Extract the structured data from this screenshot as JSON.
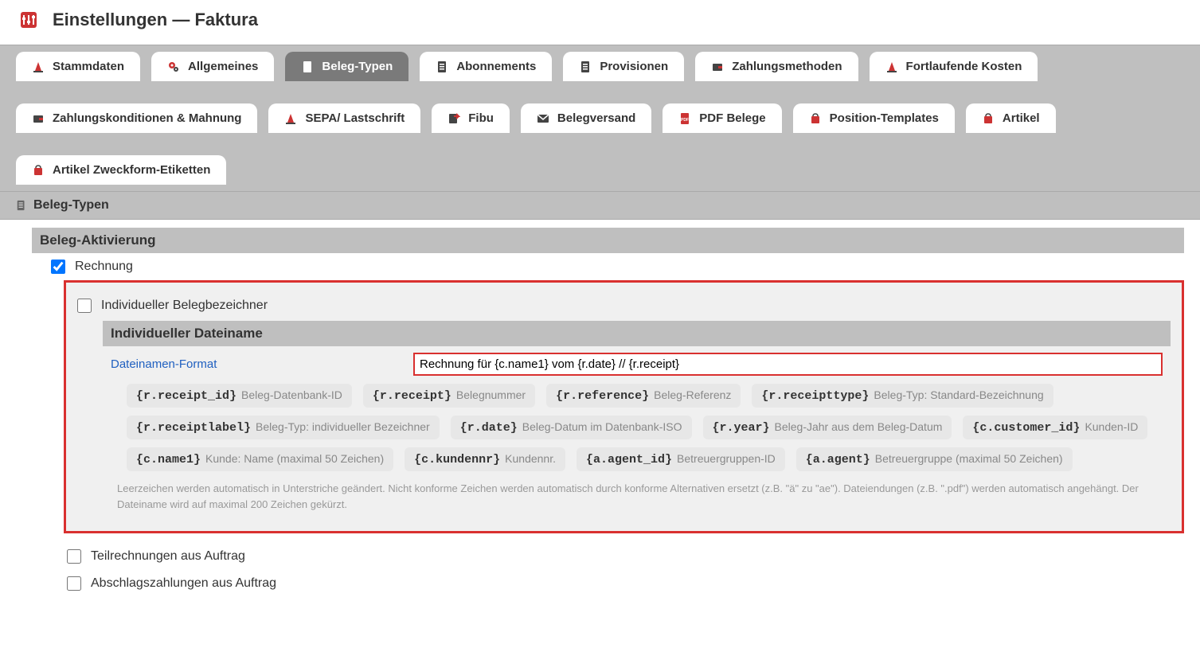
{
  "header": {
    "title": "Einstellungen — Faktura"
  },
  "tabs": {
    "row1": [
      {
        "label": "Stammdaten",
        "icon": "cone"
      },
      {
        "label": "Allgemeines",
        "icon": "gears"
      },
      {
        "label": "Beleg-Typen",
        "icon": "doc",
        "active": true
      },
      {
        "label": "Abonnements",
        "icon": "doc"
      },
      {
        "label": "Provisionen",
        "icon": "doc"
      },
      {
        "label": "Zahlungsmethoden",
        "icon": "wallet"
      },
      {
        "label": "Fortlaufende Kosten",
        "icon": "cone"
      }
    ],
    "row2": [
      {
        "label": "Zahlungskonditionen & Mahnung",
        "icon": "wallet"
      },
      {
        "label": "SEPA/ Lastschrift",
        "icon": "cone"
      },
      {
        "label": "Fibu",
        "icon": "export"
      },
      {
        "label": "Belegversand",
        "icon": "mail"
      },
      {
        "label": "PDF Belege",
        "icon": "pdf"
      },
      {
        "label": "Position-Templates",
        "icon": "bag"
      },
      {
        "label": "Artikel",
        "icon": "bag"
      }
    ],
    "row3": [
      {
        "label": "Artikel Zweckform-Etiketten",
        "icon": "bag"
      }
    ]
  },
  "section_header": "Beleg-Typen",
  "panel": {
    "title": "Beleg-Aktivierung",
    "rechnung_label": "Rechnung",
    "rechnung_checked": true,
    "individueller_bezeichner_label": "Individueller Belegbezeichner",
    "individueller_bezeichner_checked": false,
    "dateiname_title": "Individueller Dateiname",
    "format_label": "Dateinamen-Format",
    "format_value": "Rechnung für {c.name1} vom {r.date} // {r.receipt}",
    "tags": [
      {
        "code": "{r.receipt_id}",
        "desc": "Beleg-Datenbank-ID"
      },
      {
        "code": "{r.receipt}",
        "desc": "Belegnummer"
      },
      {
        "code": "{r.reference}",
        "desc": "Beleg-Referenz"
      },
      {
        "code": "{r.receipttype}",
        "desc": "Beleg-Typ: Standard-Bezeichnung"
      },
      {
        "code": "{r.receiptlabel}",
        "desc": "Beleg-Typ: individueller Bezeichner"
      },
      {
        "code": "{r.date}",
        "desc": "Beleg-Datum im Datenbank-ISO"
      },
      {
        "code": "{r.year}",
        "desc": "Beleg-Jahr aus dem Beleg-Datum"
      },
      {
        "code": "{c.customer_id}",
        "desc": "Kunden-ID"
      },
      {
        "code": "{c.name1}",
        "desc": "Kunde: Name (maximal 50 Zeichen)"
      },
      {
        "code": "{c.kundennr}",
        "desc": "Kundennr."
      },
      {
        "code": "{a.agent_id}",
        "desc": "Betreuergruppen-ID"
      },
      {
        "code": "{a.agent}",
        "desc": "Betreuergruppe (maximal 50 Zeichen)"
      }
    ],
    "hint": "Leerzeichen werden automatisch in Unterstriche geändert. Nicht konforme Zeichen werden automatisch durch konforme Alternativen ersetzt (z.B. \"ä\" zu \"ae\"). Dateiendungen (z.B. \".pdf\") werden automatisch angehängt. Der Dateiname wird auf maximal 200 Zeichen gekürzt.",
    "teilrechnungen_label": "Teilrechnungen aus Auftrag",
    "teilrechnungen_checked": false,
    "abschlag_label": "Abschlagszahlungen aus Auftrag",
    "abschlag_checked": false
  }
}
